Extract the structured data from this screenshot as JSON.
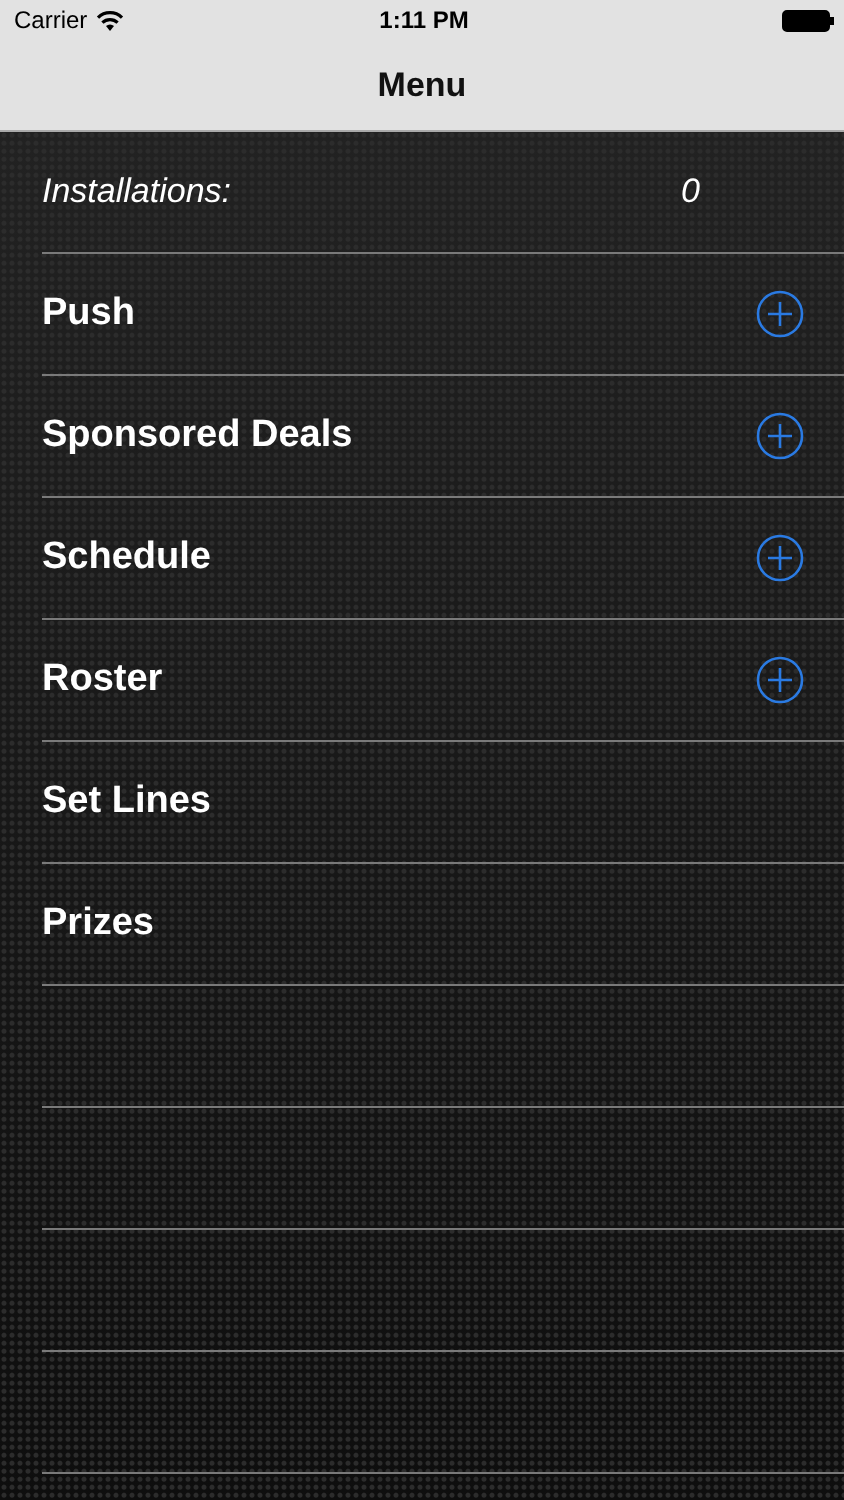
{
  "status_bar": {
    "carrier": "Carrier",
    "time": "1:11 PM"
  },
  "nav_bar": {
    "title": "Menu"
  },
  "installations": {
    "label": "Installations:",
    "value": "0"
  },
  "items": [
    {
      "label": "Push",
      "has_add": true
    },
    {
      "label": "Sponsored Deals",
      "has_add": true
    },
    {
      "label": "Schedule",
      "has_add": true
    },
    {
      "label": "Roster",
      "has_add": true
    },
    {
      "label": "Set Lines",
      "has_add": false
    },
    {
      "label": "Prizes",
      "has_add": false
    }
  ]
}
